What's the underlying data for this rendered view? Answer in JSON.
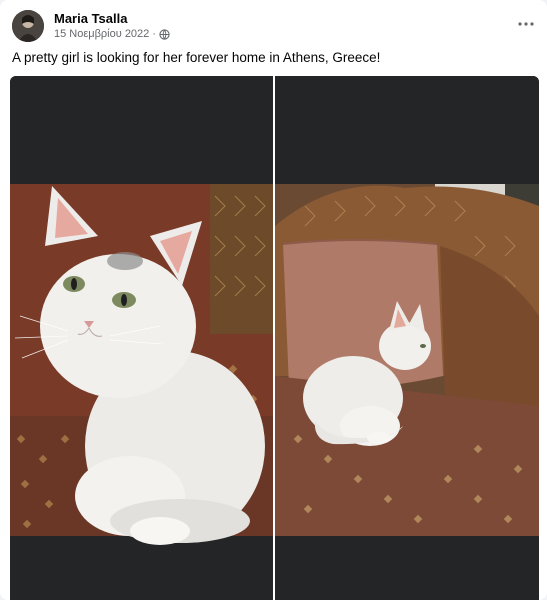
{
  "post": {
    "author": "Maria Tsalla",
    "date": "15 Νοεμβρίου 2022",
    "audience_icon": "globe-icon",
    "more_icon": "more-options-icon",
    "caption": "A pretty girl is looking for her forever home in Athens, Greece!"
  },
  "photos": [
    {
      "subject": "white-kitten-closeup"
    },
    {
      "subject": "white-kitten-on-sofa"
    }
  ],
  "colors": {
    "photo_background": "#242526",
    "secondary_text": "#65676b",
    "sofa_fabric": "#8a5a35",
    "cushion": "#b07a68"
  }
}
